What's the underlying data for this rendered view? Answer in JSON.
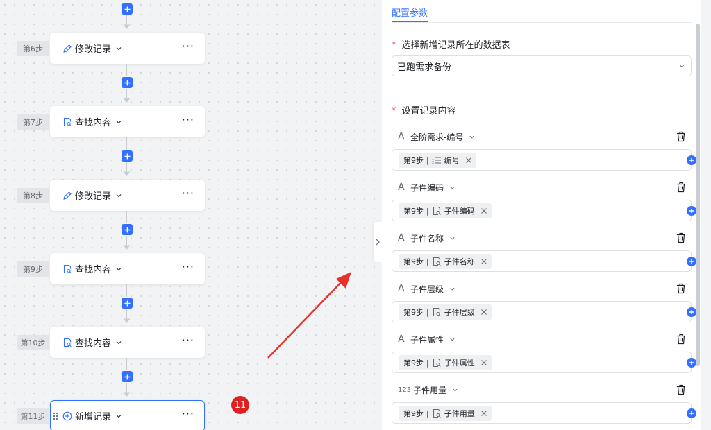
{
  "workflow": {
    "steps": [
      {
        "label": "第6步",
        "title": "修改记录",
        "icon": "pencil-icon"
      },
      {
        "label": "第7步",
        "title": "查找内容",
        "icon": "document-search-icon"
      },
      {
        "label": "第8步",
        "title": "修改记录",
        "icon": "pencil-icon"
      },
      {
        "label": "第9步",
        "title": "查找内容",
        "icon": "document-search-icon"
      },
      {
        "label": "第10步",
        "title": "查找内容",
        "icon": "document-search-icon"
      },
      {
        "label": "第11步",
        "title": "新增记录",
        "icon": "plus-circle-icon"
      }
    ],
    "more_label": "···",
    "annotation_badge": "11"
  },
  "panel": {
    "tab_label": "配置参数",
    "table_section_label": "选择新增记录所在的数据表",
    "table_value": "已跑需求备份",
    "content_section_label": "设置记录内容",
    "required_mark": "*",
    "fields": [
      {
        "type_icon": "text-type-icon",
        "type_glyph": "A",
        "name": "全阶需求-编号",
        "chip_step": "第9步",
        "chip_icon": "numbered-list-icon",
        "chip_value": "编号"
      },
      {
        "type_icon": "text-type-icon",
        "type_glyph": "A",
        "name": "子件编码",
        "chip_step": "第9步",
        "chip_icon": "document-search-icon",
        "chip_value": "子件编码"
      },
      {
        "type_icon": "text-type-icon",
        "type_glyph": "A",
        "name": "子件名称",
        "chip_step": "第9步",
        "chip_icon": "document-search-icon",
        "chip_value": "子件名称"
      },
      {
        "type_icon": "text-type-icon",
        "type_glyph": "A",
        "name": "子件层级",
        "chip_step": "第9步",
        "chip_icon": "document-search-icon",
        "chip_value": "子件层级"
      },
      {
        "type_icon": "text-type-icon",
        "type_glyph": "A",
        "name": "子件属性",
        "chip_step": "第9步",
        "chip_icon": "document-search-icon",
        "chip_value": "子件属性"
      },
      {
        "type_icon": "number-type-icon",
        "type_glyph": "123",
        "name": "子件用量",
        "chip_step": "第9步",
        "chip_icon": "document-search-icon",
        "chip_value": "子件用量"
      }
    ]
  },
  "colors": {
    "accent": "#3370ff",
    "required": "#f54a45",
    "badge": "#e02020",
    "annotation_arrow": "#e8312a"
  }
}
